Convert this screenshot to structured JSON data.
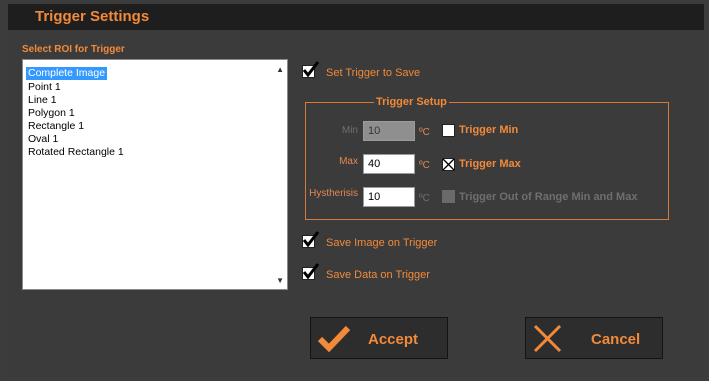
{
  "window": {
    "title": "Trigger Settings"
  },
  "roi": {
    "label": "Select ROI for Trigger",
    "items": [
      "Complete Image",
      "Point 1",
      "Line 1",
      "Polygon 1",
      "Rectangle 1",
      "Oval 1",
      "Rotated Rectangle 1"
    ],
    "selected_index": 0
  },
  "options": {
    "set_trigger_to_save": {
      "label": "Set Trigger to Save",
      "checked": true
    },
    "save_image_on_trigger": {
      "label": "Save Image on Trigger",
      "checked": true
    },
    "save_data_on_trigger": {
      "label": "Save Data on Trigger",
      "checked": true
    }
  },
  "trigger_setup": {
    "title": "Trigger Setup",
    "min": {
      "label": "Min",
      "value": "10",
      "unit": "ºC",
      "enabled": false
    },
    "max": {
      "label": "Max",
      "value": "40",
      "unit": "ºC",
      "enabled": true
    },
    "hysteresis": {
      "label": "Hystherisis",
      "value": "10",
      "unit": "ºC",
      "enabled": true
    },
    "trigger_min": {
      "label": "Trigger Min",
      "checked": false
    },
    "trigger_max": {
      "label": "Trigger Max",
      "checked": true
    },
    "trigger_out_of_range": {
      "label": "Trigger Out of Range Min and Max",
      "checked": false,
      "enabled": false
    }
  },
  "buttons": {
    "accept": {
      "label": "Accept",
      "icon": "checkmark-icon"
    },
    "cancel": {
      "label": "Cancel",
      "icon": "x-icon"
    }
  },
  "colors": {
    "accent": "#f28a3a",
    "background": "#3b3b3b",
    "titlebar": "#1e1e1e"
  }
}
